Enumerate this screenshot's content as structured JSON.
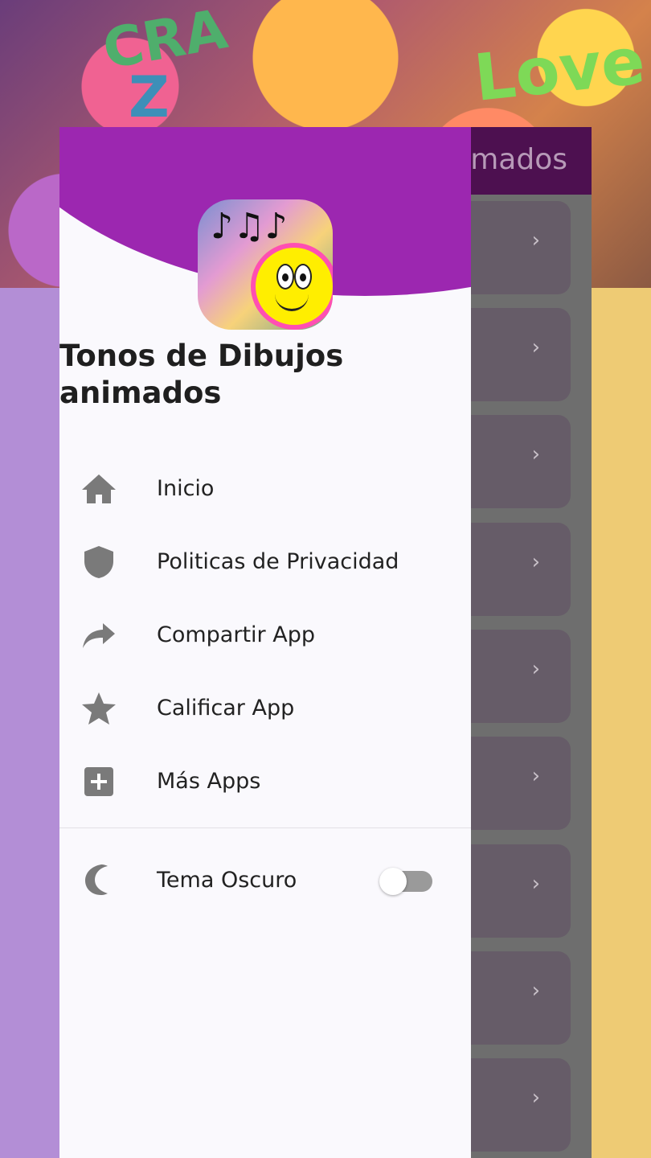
{
  "appbar": {
    "title": "mados"
  },
  "drawer": {
    "title": "Tonos de Dibujos animados",
    "menu": [
      {
        "label": "Inicio",
        "icon": "home-icon"
      },
      {
        "label": "Politicas de Privacidad",
        "icon": "shield-icon"
      },
      {
        "label": "Compartir App",
        "icon": "share-icon"
      },
      {
        "label": "Calificar App",
        "icon": "star-icon"
      },
      {
        "label": "Más Apps",
        "icon": "add-box-icon"
      }
    ],
    "dark_theme": {
      "label": "Tema Oscuro",
      "icon": "moon-icon",
      "enabled": false
    }
  },
  "list": {
    "chevron": "›"
  },
  "colors": {
    "drawer_header": "#9c27b0",
    "appbar": "#4d1050",
    "icon_gray": "#7a7a7a"
  }
}
